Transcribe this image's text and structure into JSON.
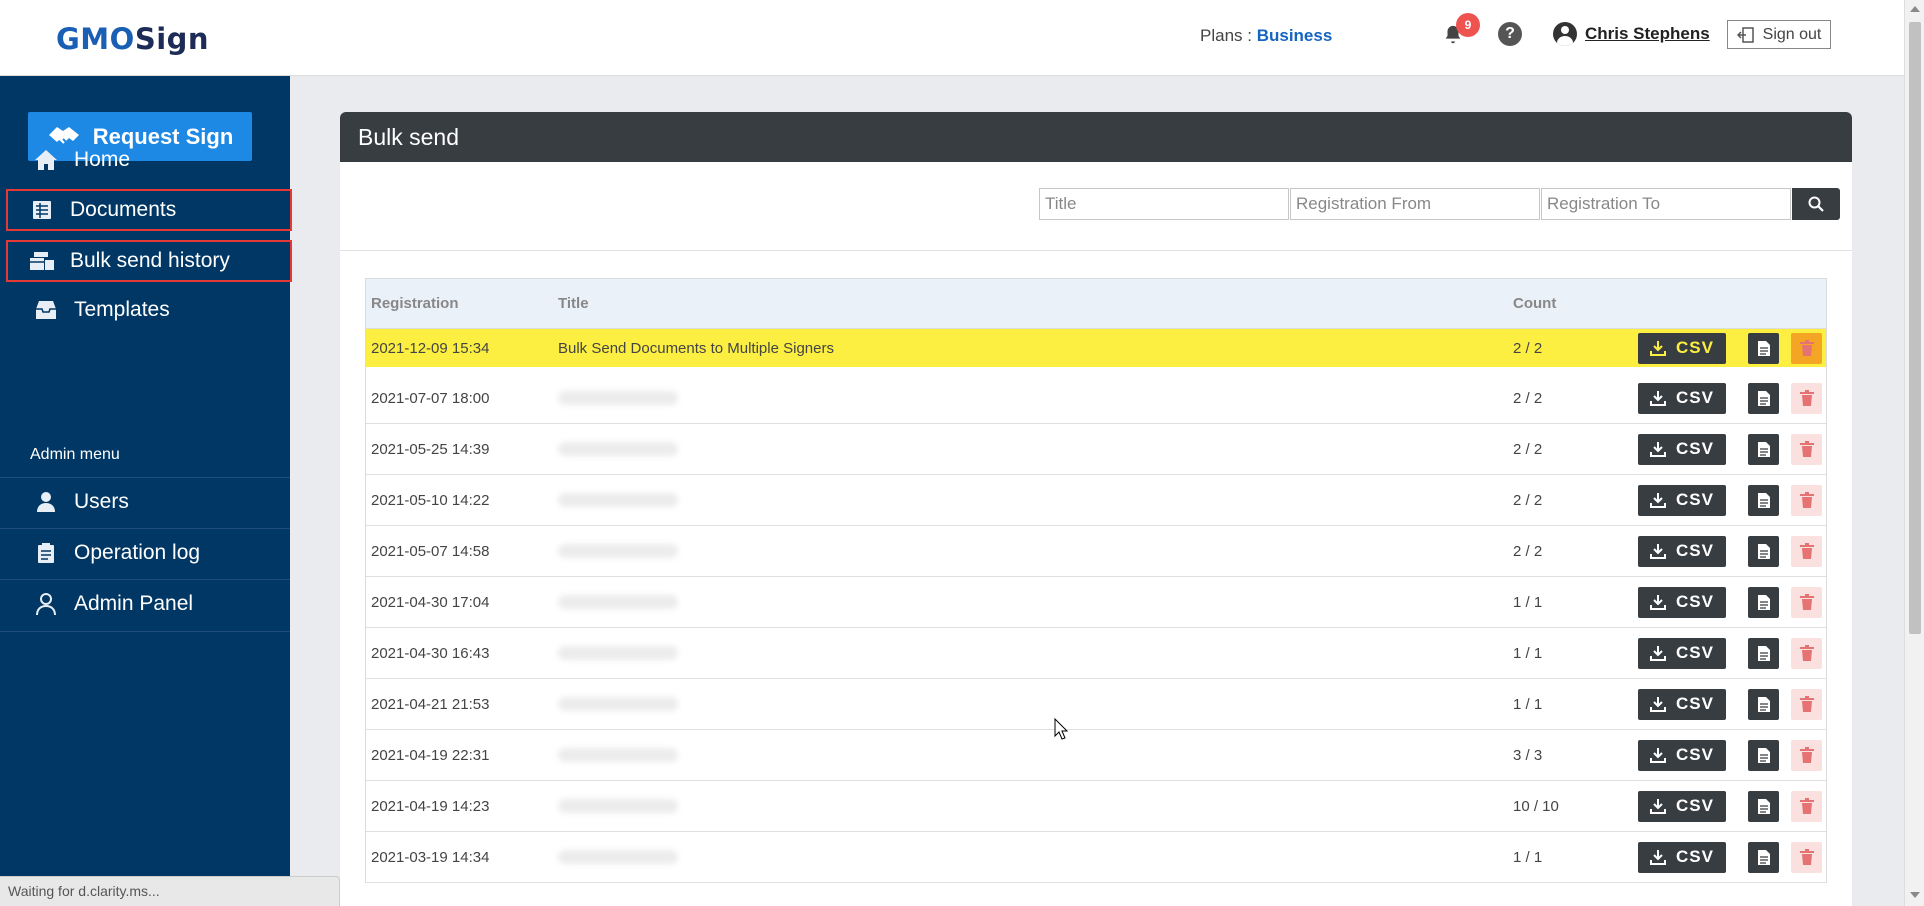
{
  "header": {
    "logo_part1": "GMO",
    "logo_part2": "Sign",
    "plans_label": "Plans : ",
    "plans_value": "Business",
    "notification_count": "9",
    "help_label": "?",
    "user_name": "Chris Stephens",
    "signout_label": "Sign out"
  },
  "sidebar": {
    "request_button": "Request Sign",
    "items": [
      {
        "label": "Home",
        "icon": "home-icon"
      },
      {
        "label": "Documents",
        "icon": "documents-icon"
      },
      {
        "label": "Bulk send history",
        "icon": "bulk-send-icon"
      },
      {
        "label": "Templates",
        "icon": "templates-icon"
      }
    ],
    "admin_label": "Admin menu",
    "admin_items": [
      {
        "label": "Users",
        "icon": "user-icon"
      },
      {
        "label": "Operation log",
        "icon": "log-icon"
      },
      {
        "label": "Admin Panel",
        "icon": "admin-icon"
      }
    ]
  },
  "main": {
    "title": "Bulk send",
    "filters": {
      "title_placeholder": "Title",
      "from_placeholder": "Registration From",
      "to_placeholder": "Registration To"
    },
    "table": {
      "headers": [
        "Registration",
        "Title",
        "Count"
      ],
      "csv_label": "CSV",
      "rows": [
        {
          "date": "2021-12-09 15:34",
          "title": "Bulk Send Documents to Multiple Signers",
          "count": "2 / 2"
        },
        {
          "date": "2021-07-07 18:00",
          "title": "",
          "count": "2 / 2"
        },
        {
          "date": "2021-05-25 14:39",
          "title": "",
          "count": "2 / 2"
        },
        {
          "date": "2021-05-10 14:22",
          "title": "",
          "count": "2 / 2"
        },
        {
          "date": "2021-05-07 14:58",
          "title": "",
          "count": "2 / 2"
        },
        {
          "date": "2021-04-30 17:04",
          "title": "",
          "count": "1 / 1"
        },
        {
          "date": "2021-04-30 16:43",
          "title": "",
          "count": "1 / 1"
        },
        {
          "date": "2021-04-21 21:53",
          "title": "",
          "count": "1 / 1"
        },
        {
          "date": "2021-04-19 22:31",
          "title": "",
          "count": "3 / 3"
        },
        {
          "date": "2021-04-19 14:23",
          "title": "",
          "count": "10 / 10"
        },
        {
          "date": "2021-03-19 14:34",
          "title": "",
          "count": "1 / 1"
        }
      ]
    }
  },
  "status_bar": "Waiting for d.clarity.ms...",
  "colors": {
    "sidebar_bg": "#003764",
    "accent_blue": "#1e88e5",
    "highlight_row": "#fcef42",
    "dark_button": "#383d42",
    "selection_outline": "#e53935"
  }
}
